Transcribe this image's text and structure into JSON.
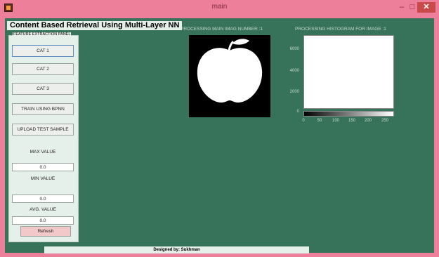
{
  "window": {
    "title": "main",
    "minimize": "–",
    "maximize": "□",
    "close": "✕"
  },
  "app_title": "Content Based Retrieval Using Multi-Layer NN",
  "panel": {
    "title": "FEATURE EXTRACTION PANEL",
    "buttons": [
      "CAT 1",
      "CAT 2",
      "CAT 3",
      "TRAIN USING BPNN",
      "UPLOAD TEST SAMPLE"
    ],
    "max_label": "MAX VALUE",
    "max_value": "0.0",
    "min_label": "MIN VALUE",
    "min_value": "0.0",
    "avg_label": "AVG. VALUE",
    "avg_value": "0.0",
    "refresh": "Refresh"
  },
  "image_panel": {
    "title": "PROCESSING MAIN IMAG NUMBER :1"
  },
  "histogram_panel": {
    "title": "PROCESSING HISTOGRAM FOR IMAGE :1",
    "y_ticks": [
      "6000",
      "4000",
      "2000",
      "0"
    ],
    "x_ticks": [
      "0",
      "50",
      "100",
      "150",
      "200",
      "250"
    ]
  },
  "footer": "Designed by: Sukhman",
  "colors": {
    "background": "#36735a",
    "titlebar": "#ee7f9b",
    "panel": "#e6f0ea",
    "refresh": "#f2c8c8"
  }
}
